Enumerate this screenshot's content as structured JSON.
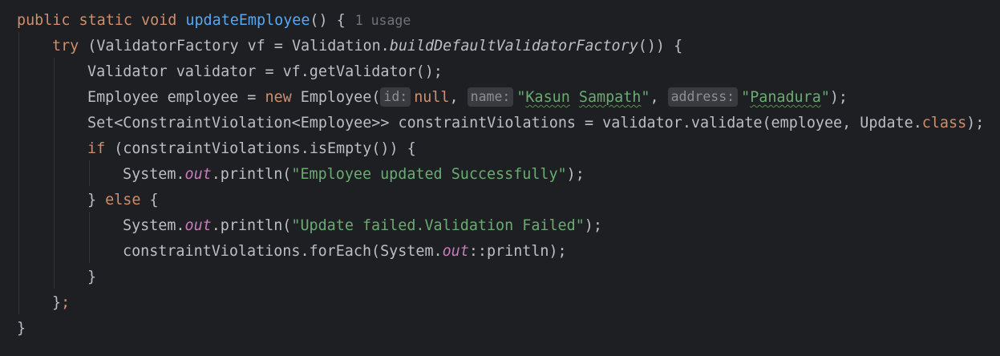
{
  "code": {
    "l1": {
      "kw_public": "public",
      "kw_static": "static",
      "kw_void": "void",
      "method_name": "updateEmployee",
      "suffix": "() {",
      "usage_hint": "1 usage"
    },
    "l2": {
      "kw_try": "try",
      "t1": " (ValidatorFactory vf = Validation.",
      "call": "buildDefaultValidatorFactory",
      "t2": "()) {"
    },
    "l3": {
      "text": "Validator validator = vf.getValidator();"
    },
    "l4": {
      "t1": "Employee employee = ",
      "kw_new": "new",
      "t2": " Employee(",
      "hint_id": "id:",
      "null_val": "null",
      "comma1": ", ",
      "hint_name": "name:",
      "quote_open1": "\"",
      "name_first": "Kasun",
      "name_space": " ",
      "name_last": "Sampath",
      "quote_close1": "\"",
      "comma2": ", ",
      "hint_address": "address:",
      "quote_open2": "\"",
      "address_val": "Panadura",
      "quote_close2": "\"",
      "t3": ");"
    },
    "l5": {
      "t1": "Set<ConstraintViolation<Employee>> constraintViolations = validator.validate(employee, Update.",
      "kw_class": "class",
      "t2": ");"
    },
    "l6": {
      "kw_if": "if",
      "t1": " (constraintViolations.isEmpty()) {"
    },
    "l7": {
      "t1": "System.",
      "field_out": "out",
      "t2": ".println(",
      "string": "\"Employee updated Successfully\"",
      "t3": ");"
    },
    "l8": {
      "t1": "} ",
      "kw_else": "else",
      "t2": " {"
    },
    "l9": {
      "t1": "System.",
      "field_out": "out",
      "t2": ".println(",
      "string": "\"Update failed.Validation Failed\"",
      "t3": ");"
    },
    "l10": {
      "t1": "constraintViolations.forEach(System.",
      "field_out": "out",
      "t2": "::println);"
    },
    "l11": {
      "text": "}"
    },
    "l12": {
      "brace": "}",
      "semicolon": ";"
    },
    "l13": {
      "text": "}"
    }
  },
  "colors": {
    "background": "#1e1f22",
    "keyword": "#cf8e6d",
    "method_declaration": "#56a8f5",
    "string": "#6aab73",
    "static_field": "#c77dbb",
    "default_text": "#bcbec4",
    "inlay_hint_bg": "#393b40",
    "inlay_hint_text": "#8c8f96",
    "usage_hint_text": "#6f737a",
    "indent_guide": "#313438"
  }
}
